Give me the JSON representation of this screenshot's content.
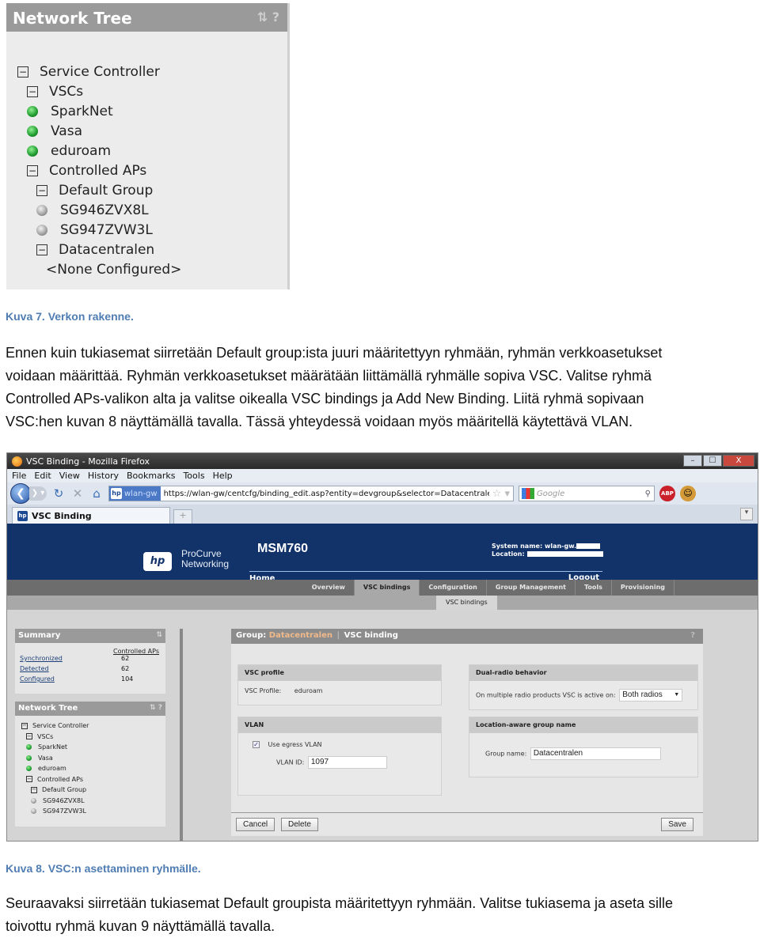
{
  "figure7": {
    "header_title": "Network Tree",
    "header_icons": [
      "refresh-icon",
      "help-icon"
    ],
    "tree": [
      {
        "label": "Service Controller",
        "level": 0,
        "type": "expanded"
      },
      {
        "label": "VSCs",
        "level": 1,
        "type": "expanded"
      },
      {
        "label": "SparkNet",
        "level": 1,
        "type": "green"
      },
      {
        "label": "Vasa",
        "level": 1,
        "type": "green"
      },
      {
        "label": "eduroam",
        "level": 1,
        "type": "green"
      },
      {
        "label": "Controlled APs",
        "level": 1,
        "type": "expanded"
      },
      {
        "label": "Default Group",
        "level": 2,
        "type": "expanded"
      },
      {
        "label": "SG946ZVX8L",
        "level": 2,
        "type": "grey"
      },
      {
        "label": "SG947ZVW3L",
        "level": 2,
        "type": "grey"
      },
      {
        "label": "Datacentralen",
        "level": 2,
        "type": "expanded"
      },
      {
        "label": "<None Configured>",
        "level": 3,
        "type": "text"
      }
    ],
    "caption": "Kuva 7. Verkon rakenne."
  },
  "paragraph1": [
    "Ennen kuin tukiasemat siirretään Default group:ista juuri määritettyyn ryhmään, ryhmän verkkoasetukset",
    "voidaan määrittää. Ryhmän verkkoasetukset määrätään liittämällä ryhmälle sopiva VSC. Valitse ryhmä",
    "Controlled APs-valikon alta ja valitse oikealla VSC bindings ja Add New Binding. Liitä ryhmä sopivaan",
    "VSC:hen kuvan 8 näyttämällä tavalla. Tässä yhteydessä voidaan myös määritellä käytettävä VLAN."
  ],
  "figure8": {
    "window_title": "VSC Binding - Mozilla Firefox",
    "window_buttons": {
      "minimize": "–",
      "maximize": "☐",
      "close": "X"
    },
    "menu": [
      "File",
      "Edit",
      "View",
      "History",
      "Bookmarks",
      "Tools",
      "Help"
    ],
    "site_identity": "wlan-gw",
    "url": "https://wlan-gw/centcfg/binding_edit.asp?entity=devgroup&selector=Datacentralen",
    "search_placeholder": "Google",
    "tab_label": "VSC Binding",
    "new_tab": "+",
    "page": {
      "brand_line1": "ProCurve",
      "brand_line2": "Networking",
      "hp_logo": "hp",
      "product": "MSM760",
      "system_name_label": "System name: wlan-gw.",
      "location_label": "Location:",
      "home": "Home",
      "logout": "Logout",
      "main_tabs": [
        "Overview",
        "VSC bindings",
        "Configuration",
        "Group Management",
        "Tools",
        "Provisioning"
      ],
      "active_tab": "VSC bindings",
      "sub_tab": "VSC bindings",
      "summary": {
        "title": "Summary",
        "column_header": "Controlled APs",
        "rows": [
          {
            "label": "Synchronized",
            "value": "62"
          },
          {
            "label": "Detected",
            "value": "62"
          },
          {
            "label": "Configured",
            "value": "104"
          }
        ]
      },
      "network_tree": {
        "title": "Network Tree",
        "items": [
          {
            "label": "Service Controller",
            "type": "expanded",
            "level": 0
          },
          {
            "label": "VSCs",
            "type": "expanded",
            "level": 1
          },
          {
            "label": "SparkNet",
            "type": "green",
            "level": 1
          },
          {
            "label": "Vasa",
            "type": "green",
            "level": 1
          },
          {
            "label": "eduroam",
            "type": "green",
            "level": 1
          },
          {
            "label": "Controlled APs",
            "type": "expanded",
            "level": 1
          },
          {
            "label": "Default Group",
            "type": "expanded",
            "level": 2
          },
          {
            "label": "SG946ZVX8L",
            "type": "grey",
            "level": 2
          },
          {
            "label": "SG947ZVW3L",
            "type": "grey",
            "level": 2
          }
        ]
      },
      "content": {
        "group_label": "Group:",
        "group_name": "Datacentralen",
        "separator": "|",
        "section": "VSC binding",
        "help": "?",
        "vsc_profile": {
          "title": "VSC profile",
          "label": "VSC Profile:",
          "value": "eduroam"
        },
        "dual_radio": {
          "title": "Dual-radio behavior",
          "label": "On multiple radio products VSC is active on:",
          "value": "Both radios"
        },
        "vlan": {
          "title": "VLAN",
          "checkbox_label": "Use egress VLAN",
          "checked": true,
          "id_label": "VLAN ID:",
          "id_value": "1097"
        },
        "location": {
          "title": "Location-aware group name",
          "label": "Group name:",
          "value": "Datacentralen"
        },
        "buttons": {
          "cancel": "Cancel",
          "delete": "Delete",
          "save": "Save"
        }
      }
    },
    "caption": "Kuva 8.  VSC:n asettaminen ryhmälle."
  },
  "paragraph2": [
    "Seuraavaksi siirretään tukiasemat Default groupista määritettyyn ryhmään. Valitse tukiasema ja aseta sille",
    "toivottu ryhmä kuvan 9 näyttämällä tavalla."
  ]
}
